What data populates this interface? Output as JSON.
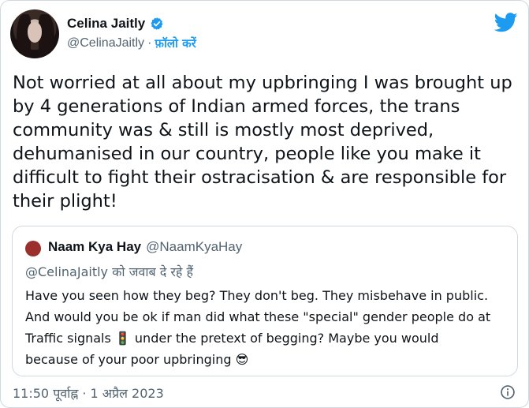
{
  "author": {
    "name": "Celina Jaitly",
    "handle": "@CelinaJaitly",
    "separator": "·",
    "follow_label": "फ़ॉलो करें"
  },
  "tweet": {
    "text": "Not worried at all about my upbringing I was brought up by 4 generations of Indian armed forces, the trans community was & still is mostly most deprived, dehumanised in our country, people like you make it difficult to fight their ostracisation & are responsible for their plight!"
  },
  "quoted": {
    "name": "Naam Kya Hay",
    "handle": "@NaamKyaHay",
    "reply_line": "@CelinaJaitly को जवाब दे रहे हैं",
    "lines": [
      "Have you seen how they beg? They don't beg. They misbehave in public.",
      "And would you be ok if man did what these \"special\" gender people do at",
      "Traffic signals 🚦 under the pretext of begging? Maybe you would",
      "because of your poor upbringing 😎"
    ]
  },
  "footer": {
    "timestamp": "11:50 पूर्वाह्न · 1 अप्रैल 2023"
  },
  "colors": {
    "accent": "#1d9bf0",
    "text": "#0f1419",
    "muted": "#536471",
    "border": "#cfd9de"
  }
}
